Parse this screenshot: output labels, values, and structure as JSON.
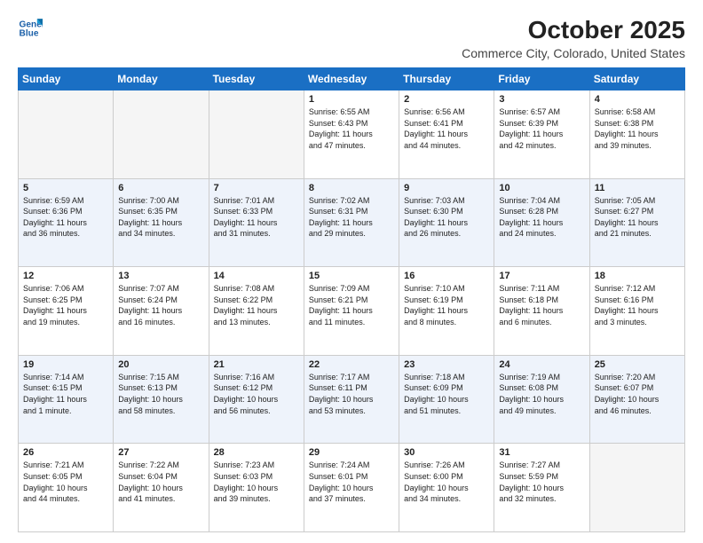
{
  "logo": {
    "line1": "General",
    "line2": "Blue"
  },
  "header": {
    "month": "October 2025",
    "location": "Commerce City, Colorado, United States"
  },
  "days": [
    "Sunday",
    "Monday",
    "Tuesday",
    "Wednesday",
    "Thursday",
    "Friday",
    "Saturday"
  ],
  "weeks": [
    [
      {
        "day": "",
        "info": ""
      },
      {
        "day": "",
        "info": ""
      },
      {
        "day": "",
        "info": ""
      },
      {
        "day": "1",
        "info": "Sunrise: 6:55 AM\nSunset: 6:43 PM\nDaylight: 11 hours\nand 47 minutes."
      },
      {
        "day": "2",
        "info": "Sunrise: 6:56 AM\nSunset: 6:41 PM\nDaylight: 11 hours\nand 44 minutes."
      },
      {
        "day": "3",
        "info": "Sunrise: 6:57 AM\nSunset: 6:39 PM\nDaylight: 11 hours\nand 42 minutes."
      },
      {
        "day": "4",
        "info": "Sunrise: 6:58 AM\nSunset: 6:38 PM\nDaylight: 11 hours\nand 39 minutes."
      }
    ],
    [
      {
        "day": "5",
        "info": "Sunrise: 6:59 AM\nSunset: 6:36 PM\nDaylight: 11 hours\nand 36 minutes."
      },
      {
        "day": "6",
        "info": "Sunrise: 7:00 AM\nSunset: 6:35 PM\nDaylight: 11 hours\nand 34 minutes."
      },
      {
        "day": "7",
        "info": "Sunrise: 7:01 AM\nSunset: 6:33 PM\nDaylight: 11 hours\nand 31 minutes."
      },
      {
        "day": "8",
        "info": "Sunrise: 7:02 AM\nSunset: 6:31 PM\nDaylight: 11 hours\nand 29 minutes."
      },
      {
        "day": "9",
        "info": "Sunrise: 7:03 AM\nSunset: 6:30 PM\nDaylight: 11 hours\nand 26 minutes."
      },
      {
        "day": "10",
        "info": "Sunrise: 7:04 AM\nSunset: 6:28 PM\nDaylight: 11 hours\nand 24 minutes."
      },
      {
        "day": "11",
        "info": "Sunrise: 7:05 AM\nSunset: 6:27 PM\nDaylight: 11 hours\nand 21 minutes."
      }
    ],
    [
      {
        "day": "12",
        "info": "Sunrise: 7:06 AM\nSunset: 6:25 PM\nDaylight: 11 hours\nand 19 minutes."
      },
      {
        "day": "13",
        "info": "Sunrise: 7:07 AM\nSunset: 6:24 PM\nDaylight: 11 hours\nand 16 minutes."
      },
      {
        "day": "14",
        "info": "Sunrise: 7:08 AM\nSunset: 6:22 PM\nDaylight: 11 hours\nand 13 minutes."
      },
      {
        "day": "15",
        "info": "Sunrise: 7:09 AM\nSunset: 6:21 PM\nDaylight: 11 hours\nand 11 minutes."
      },
      {
        "day": "16",
        "info": "Sunrise: 7:10 AM\nSunset: 6:19 PM\nDaylight: 11 hours\nand 8 minutes."
      },
      {
        "day": "17",
        "info": "Sunrise: 7:11 AM\nSunset: 6:18 PM\nDaylight: 11 hours\nand 6 minutes."
      },
      {
        "day": "18",
        "info": "Sunrise: 7:12 AM\nSunset: 6:16 PM\nDaylight: 11 hours\nand 3 minutes."
      }
    ],
    [
      {
        "day": "19",
        "info": "Sunrise: 7:14 AM\nSunset: 6:15 PM\nDaylight: 11 hours\nand 1 minute."
      },
      {
        "day": "20",
        "info": "Sunrise: 7:15 AM\nSunset: 6:13 PM\nDaylight: 10 hours\nand 58 minutes."
      },
      {
        "day": "21",
        "info": "Sunrise: 7:16 AM\nSunset: 6:12 PM\nDaylight: 10 hours\nand 56 minutes."
      },
      {
        "day": "22",
        "info": "Sunrise: 7:17 AM\nSunset: 6:11 PM\nDaylight: 10 hours\nand 53 minutes."
      },
      {
        "day": "23",
        "info": "Sunrise: 7:18 AM\nSunset: 6:09 PM\nDaylight: 10 hours\nand 51 minutes."
      },
      {
        "day": "24",
        "info": "Sunrise: 7:19 AM\nSunset: 6:08 PM\nDaylight: 10 hours\nand 49 minutes."
      },
      {
        "day": "25",
        "info": "Sunrise: 7:20 AM\nSunset: 6:07 PM\nDaylight: 10 hours\nand 46 minutes."
      }
    ],
    [
      {
        "day": "26",
        "info": "Sunrise: 7:21 AM\nSunset: 6:05 PM\nDaylight: 10 hours\nand 44 minutes."
      },
      {
        "day": "27",
        "info": "Sunrise: 7:22 AM\nSunset: 6:04 PM\nDaylight: 10 hours\nand 41 minutes."
      },
      {
        "day": "28",
        "info": "Sunrise: 7:23 AM\nSunset: 6:03 PM\nDaylight: 10 hours\nand 39 minutes."
      },
      {
        "day": "29",
        "info": "Sunrise: 7:24 AM\nSunset: 6:01 PM\nDaylight: 10 hours\nand 37 minutes."
      },
      {
        "day": "30",
        "info": "Sunrise: 7:26 AM\nSunset: 6:00 PM\nDaylight: 10 hours\nand 34 minutes."
      },
      {
        "day": "31",
        "info": "Sunrise: 7:27 AM\nSunset: 5:59 PM\nDaylight: 10 hours\nand 32 minutes."
      },
      {
        "day": "",
        "info": ""
      }
    ]
  ]
}
